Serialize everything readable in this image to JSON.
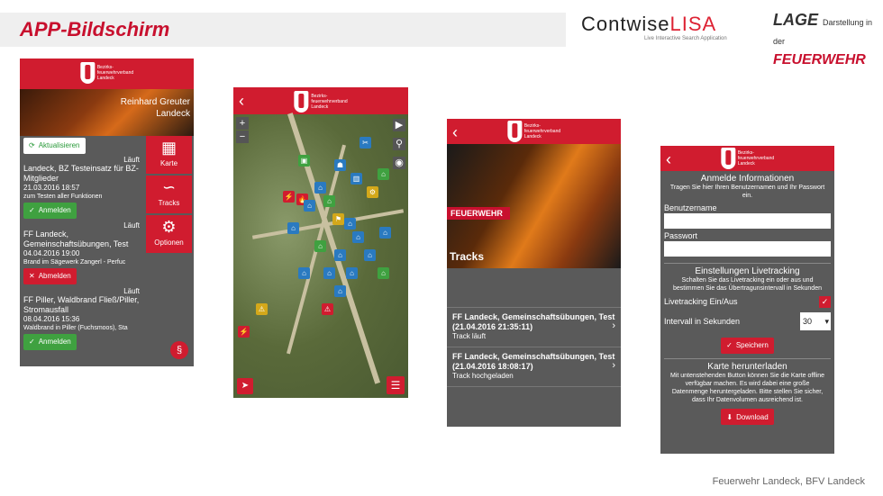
{
  "slide": {
    "title": "APP-Bildschirm",
    "footer": "Feuerwehr Landeck, BFV Landeck"
  },
  "logos": {
    "contwise_main": "Contwise",
    "contwise_lisa": "LISA",
    "contwise_sub": "Live Interactive Search Application",
    "lage_1": "LAGE",
    "lage_1b": "Darstellung in der",
    "lage_2": "FEUERWEHR"
  },
  "brand": {
    "line1": "Bezirks-",
    "line2": "feuerwehrverband",
    "line3": "Landeck"
  },
  "phone1": {
    "user_name": "Reinhard Greuter",
    "user_place": "Landeck",
    "refresh_label": "Aktualisieren",
    "tiles": [
      {
        "icon": "map-icon",
        "label": "Karte"
      },
      {
        "icon": "tracks-icon",
        "label": "Tracks"
      },
      {
        "icon": "options-icon",
        "label": "Optionen"
      }
    ],
    "events": [
      {
        "status": "Läuft",
        "title": "Landeck, BZ Testeinsatz für BZ-Mitglieder",
        "date": "21.03.2016 18:57",
        "desc": "zum Testen aller Funktionen",
        "action": "Anmelden",
        "action_type": "green"
      },
      {
        "status": "Läuft",
        "title": "FF Landeck, Gemeinschaftsübungen, Test",
        "date": "04.04.2016 19:00",
        "desc": "Brand im Sägewerk Zangerl - Perfuc",
        "action": "Abmelden",
        "action_type": "red"
      },
      {
        "status": "Läuft",
        "title": "FF Piller, Waldbrand Fließ/Piller, Stromausfall",
        "date": "08.04.2016 15:36",
        "desc": "Waldbrand in Piller (Fuchsmoos), Sta",
        "action": "Anmelden",
        "action_type": "green"
      }
    ],
    "paragraph_symbol": "§"
  },
  "phone2": {
    "zoom_in": "+",
    "zoom_out": "−"
  },
  "phone3": {
    "photo_banner": "FEUERWEHR",
    "section_label": "Tracks",
    "tracks": [
      {
        "title": "FF Landeck, Gemeinschaftsübungen, Test (21.04.2016 21:35:11)",
        "status": "Track läuft"
      },
      {
        "title": "FF Landeck, Gemeinschaftsübungen, Test (21.04.2016 18:08:17)",
        "status": "Track hochgeladen"
      }
    ]
  },
  "phone4": {
    "login_title": "Anmelde Informationen",
    "login_desc": "Tragen Sie hier Ihren Benutzernamen und Ihr Passwort ein.",
    "username_label": "Benutzername",
    "password_label": "Passwort",
    "live_title": "Einstellungen Livetracking",
    "live_desc": "Schalten Sie das Livetracking ein oder aus und bestimmen Sie das Übertragunsintervall in Sekunden",
    "live_toggle_label": "Livetracking Ein/Aus",
    "interval_label": "Intervall in Sekunden",
    "interval_value": "30",
    "save_label": "Speichern",
    "map_title": "Karte herunterladen",
    "map_desc": "Mit untenstehenden Button können Sie die Karte offline verfügbar machen. Es wird dabei eine große Datenmenge heruntergeladen. Bitte stellen Sie sicher, dass Ihr Datenvolumen ausreichend ist.",
    "download_label": "Download"
  }
}
